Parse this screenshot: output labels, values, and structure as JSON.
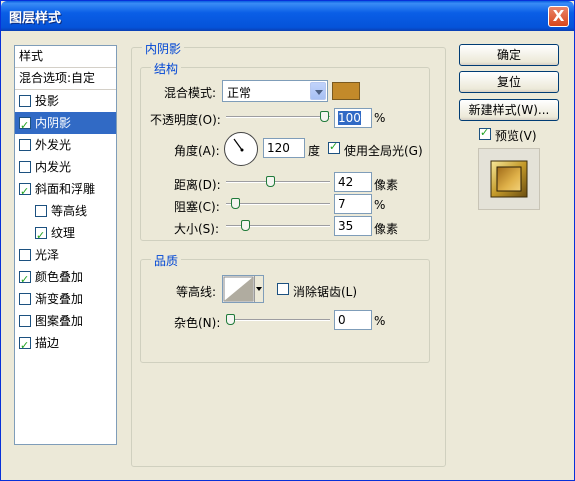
{
  "window": {
    "title": "图层样式",
    "close_label": "X"
  },
  "styles_list": {
    "header": "样式",
    "blend_options": "混合选项:自定",
    "items": [
      {
        "label": "投影",
        "checked": false,
        "sub": false,
        "selected": false
      },
      {
        "label": "内阴影",
        "checked": true,
        "sub": false,
        "selected": true
      },
      {
        "label": "外发光",
        "checked": false,
        "sub": false,
        "selected": false
      },
      {
        "label": "内发光",
        "checked": false,
        "sub": false,
        "selected": false
      },
      {
        "label": "斜面和浮雕",
        "checked": true,
        "sub": false,
        "selected": false
      },
      {
        "label": "等高线",
        "checked": false,
        "sub": true,
        "selected": false
      },
      {
        "label": "纹理",
        "checked": true,
        "sub": true,
        "selected": false
      },
      {
        "label": "光泽",
        "checked": false,
        "sub": false,
        "selected": false
      },
      {
        "label": "颜色叠加",
        "checked": true,
        "sub": false,
        "selected": false
      },
      {
        "label": "渐变叠加",
        "checked": false,
        "sub": false,
        "selected": false
      },
      {
        "label": "图案叠加",
        "checked": false,
        "sub": false,
        "selected": false
      },
      {
        "label": "描边",
        "checked": true,
        "sub": false,
        "selected": false
      }
    ]
  },
  "inner_shadow": {
    "title": "内阴影",
    "structure": {
      "title": "结构",
      "blend_mode_label": "混合模式:",
      "blend_mode_value": "正常",
      "shadow_color": "#c38a2a",
      "opacity_label": "不透明度(O):",
      "opacity_value": "100",
      "opacity_unit": "%",
      "angle_label": "角度(A):",
      "angle_value": "120",
      "angle_unit": "度",
      "global_light_label": "使用全局光(G)",
      "global_light_checked": true,
      "distance_label": "距离(D):",
      "distance_value": "42",
      "distance_unit": "像素",
      "choke_label": "阻塞(C):",
      "choke_value": "7",
      "choke_unit": "%",
      "size_label": "大小(S):",
      "size_value": "35",
      "size_unit": "像素"
    },
    "quality": {
      "title": "品质",
      "contour_label": "等高线:",
      "anti_alias_label": "消除锯齿(L)",
      "anti_alias_checked": false,
      "noise_label": "杂色(N):",
      "noise_value": "0",
      "noise_unit": "%"
    }
  },
  "buttons": {
    "ok": "确定",
    "reset": "复位",
    "new_style": "新建样式(W)...",
    "preview_label": "预览(V)",
    "preview_checked": true
  }
}
